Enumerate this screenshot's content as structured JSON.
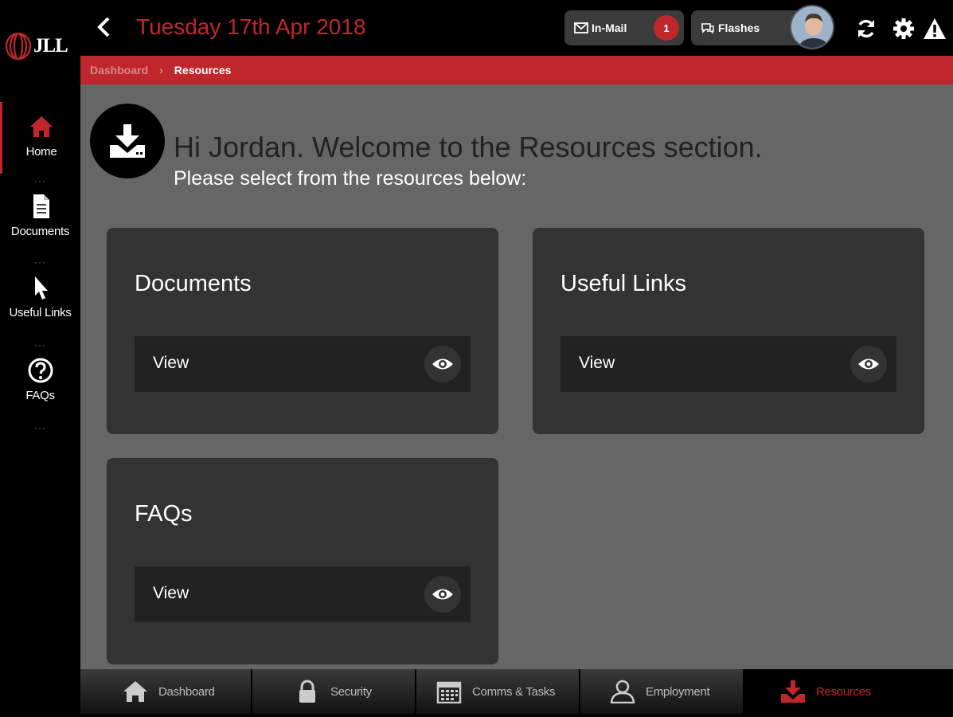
{
  "app": {
    "logo_text": "JLL",
    "date": "Tuesday 17th Apr 2018",
    "accent_color": "#c0272d"
  },
  "sidebar": {
    "items": [
      {
        "label": "Home",
        "icon": "home-icon"
      },
      {
        "label": "Documents",
        "icon": "document-icon"
      },
      {
        "label": "Useful Links",
        "icon": "pointer-icon"
      },
      {
        "label": "FAQs",
        "icon": "question-icon"
      }
    ]
  },
  "topbar": {
    "inmail_label": "In-Mail",
    "inmail_count": "1",
    "flashes_label": "Flashes",
    "icons": [
      "refresh-icon",
      "gear-icon",
      "warning-icon"
    ]
  },
  "breadcrumb": {
    "parent": "Dashboard",
    "separator": "›",
    "current": "Resources"
  },
  "main": {
    "welcome": "Hi Jordan. Welcome to the Resources section.",
    "subtitle": "Please select from the resources below:",
    "cards": [
      {
        "title": "Documents",
        "view_label": "View"
      },
      {
        "title": "Useful Links",
        "view_label": "View"
      },
      {
        "title": "FAQs",
        "view_label": "View"
      }
    ]
  },
  "bottom_nav": {
    "items": [
      {
        "label": "Dashboard",
        "icon": "home-icon"
      },
      {
        "label": "Security",
        "icon": "lock-icon"
      },
      {
        "label": "Comms & Tasks",
        "icon": "calendar-icon"
      },
      {
        "label": "Employment",
        "icon": "user-icon"
      },
      {
        "label": "Resources",
        "icon": "download-icon",
        "active": true
      }
    ]
  }
}
